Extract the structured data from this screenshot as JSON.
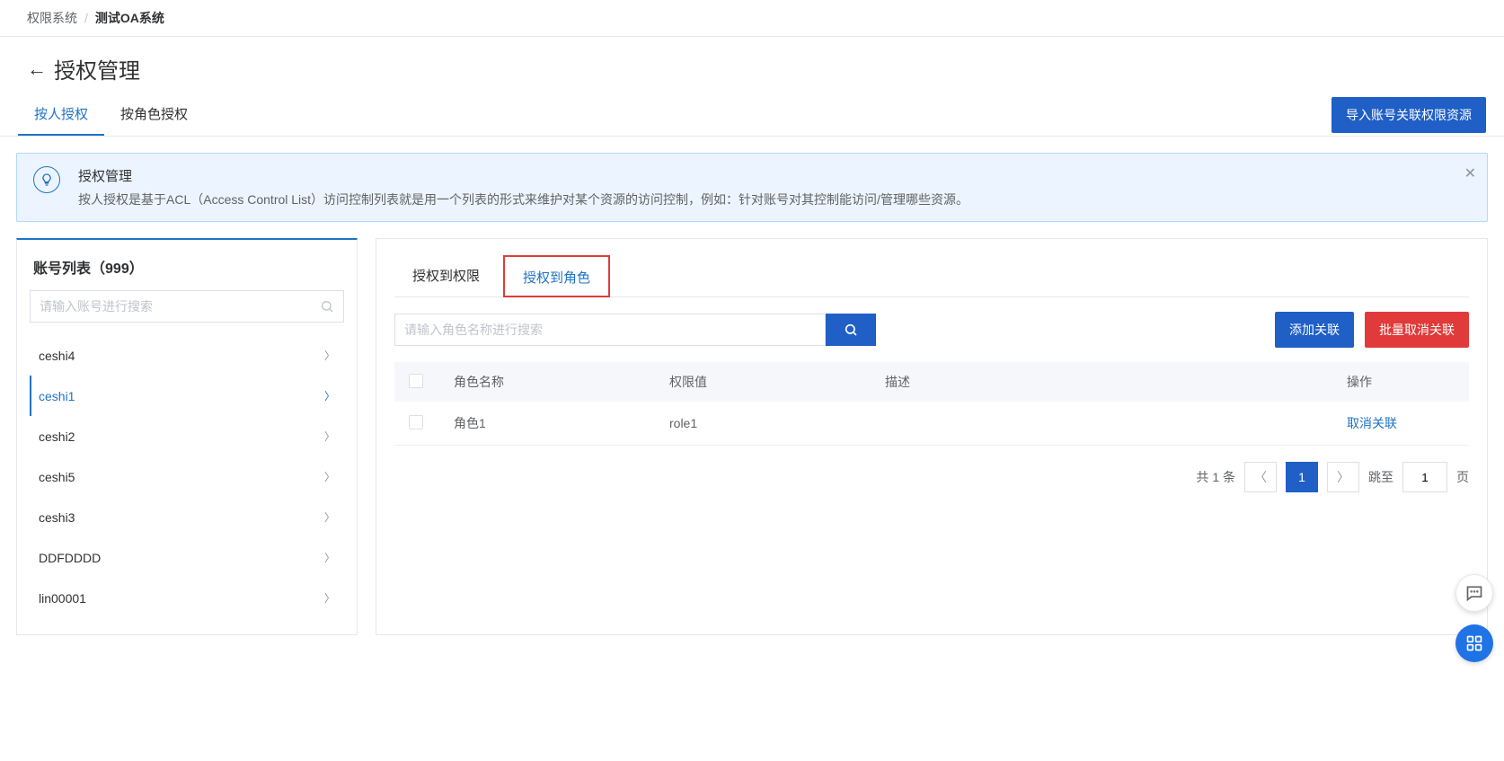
{
  "breadcrumb": {
    "item1": "权限系统",
    "item2": "测试OA系统"
  },
  "page": {
    "title": "授权管理"
  },
  "top_tabs": {
    "person": "按人授权",
    "role": "按角色授权"
  },
  "import_btn": "导入账号关联权限资源",
  "info": {
    "title": "授权管理",
    "desc": "按人授权是基于ACL（Access Control List）访问控制列表就是用一个列表的形式来维护对某个资源的访问控制，例如：针对账号对其控制能访问/管理哪些资源。"
  },
  "sidebar": {
    "title_prefix": "账号列表",
    "count": "（999）",
    "search_placeholder": "请输入账号进行搜索",
    "items": [
      {
        "label": "ceshi4",
        "active": false
      },
      {
        "label": "ceshi1",
        "active": true
      },
      {
        "label": "ceshi2",
        "active": false
      },
      {
        "label": "ceshi5",
        "active": false
      },
      {
        "label": "ceshi3",
        "active": false
      },
      {
        "label": "DDFDDDD",
        "active": false
      },
      {
        "label": "lin00001",
        "active": false
      }
    ]
  },
  "inner_tabs": {
    "to_perm": "授权到权限",
    "to_role": "授权到角色"
  },
  "role_search_placeholder": "请输入角色名称进行搜索",
  "buttons": {
    "add_relation": "添加关联",
    "bulk_cancel": "批量取消关联"
  },
  "table": {
    "headers": {
      "role_name": "角色名称",
      "perm_value": "权限值",
      "desc": "描述",
      "op": "操作"
    },
    "rows": [
      {
        "role_name": "角色1",
        "perm_value": "role1",
        "desc": "",
        "op_label": "取消关联"
      }
    ]
  },
  "pagination": {
    "total_prefix": "共",
    "total_count": "1",
    "total_suffix": "条",
    "current": "1",
    "jump_label": "跳至",
    "jump_value": "1",
    "page_suffix": "页"
  }
}
